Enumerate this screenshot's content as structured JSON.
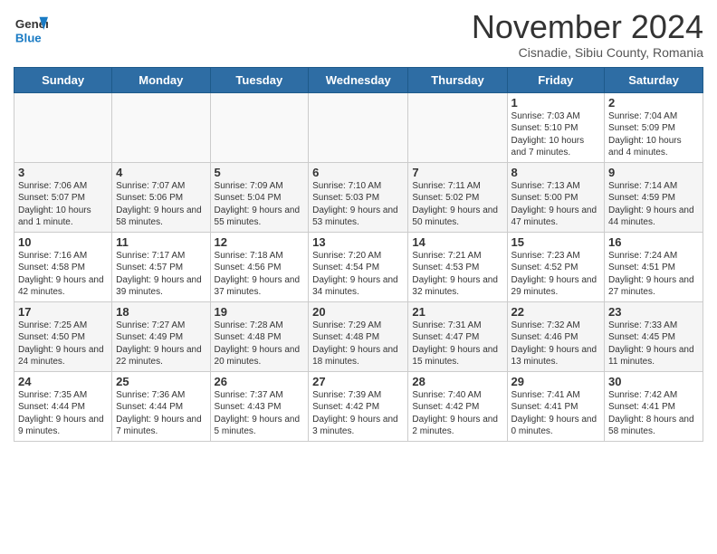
{
  "header": {
    "logo_general": "General",
    "logo_blue": "Blue",
    "month_title": "November 2024",
    "location": "Cisnadie, Sibiu County, Romania"
  },
  "days_of_week": [
    "Sunday",
    "Monday",
    "Tuesday",
    "Wednesday",
    "Thursday",
    "Friday",
    "Saturday"
  ],
  "weeks": [
    {
      "shade": "white",
      "days": [
        {
          "number": "",
          "info": "",
          "empty": true
        },
        {
          "number": "",
          "info": "",
          "empty": true
        },
        {
          "number": "",
          "info": "",
          "empty": true
        },
        {
          "number": "",
          "info": "",
          "empty": true
        },
        {
          "number": "",
          "info": "",
          "empty": true
        },
        {
          "number": "1",
          "info": "Sunrise: 7:03 AM\nSunset: 5:10 PM\nDaylight: 10 hours and 7 minutes."
        },
        {
          "number": "2",
          "info": "Sunrise: 7:04 AM\nSunset: 5:09 PM\nDaylight: 10 hours and 4 minutes."
        }
      ]
    },
    {
      "shade": "gray",
      "days": [
        {
          "number": "3",
          "info": "Sunrise: 7:06 AM\nSunset: 5:07 PM\nDaylight: 10 hours and 1 minute."
        },
        {
          "number": "4",
          "info": "Sunrise: 7:07 AM\nSunset: 5:06 PM\nDaylight: 9 hours and 58 minutes."
        },
        {
          "number": "5",
          "info": "Sunrise: 7:09 AM\nSunset: 5:04 PM\nDaylight: 9 hours and 55 minutes."
        },
        {
          "number": "6",
          "info": "Sunrise: 7:10 AM\nSunset: 5:03 PM\nDaylight: 9 hours and 53 minutes."
        },
        {
          "number": "7",
          "info": "Sunrise: 7:11 AM\nSunset: 5:02 PM\nDaylight: 9 hours and 50 minutes."
        },
        {
          "number": "8",
          "info": "Sunrise: 7:13 AM\nSunset: 5:00 PM\nDaylight: 9 hours and 47 minutes."
        },
        {
          "number": "9",
          "info": "Sunrise: 7:14 AM\nSunset: 4:59 PM\nDaylight: 9 hours and 44 minutes."
        }
      ]
    },
    {
      "shade": "white",
      "days": [
        {
          "number": "10",
          "info": "Sunrise: 7:16 AM\nSunset: 4:58 PM\nDaylight: 9 hours and 42 minutes."
        },
        {
          "number": "11",
          "info": "Sunrise: 7:17 AM\nSunset: 4:57 PM\nDaylight: 9 hours and 39 minutes."
        },
        {
          "number": "12",
          "info": "Sunrise: 7:18 AM\nSunset: 4:56 PM\nDaylight: 9 hours and 37 minutes."
        },
        {
          "number": "13",
          "info": "Sunrise: 7:20 AM\nSunset: 4:54 PM\nDaylight: 9 hours and 34 minutes."
        },
        {
          "number": "14",
          "info": "Sunrise: 7:21 AM\nSunset: 4:53 PM\nDaylight: 9 hours and 32 minutes."
        },
        {
          "number": "15",
          "info": "Sunrise: 7:23 AM\nSunset: 4:52 PM\nDaylight: 9 hours and 29 minutes."
        },
        {
          "number": "16",
          "info": "Sunrise: 7:24 AM\nSunset: 4:51 PM\nDaylight: 9 hours and 27 minutes."
        }
      ]
    },
    {
      "shade": "gray",
      "days": [
        {
          "number": "17",
          "info": "Sunrise: 7:25 AM\nSunset: 4:50 PM\nDaylight: 9 hours and 24 minutes."
        },
        {
          "number": "18",
          "info": "Sunrise: 7:27 AM\nSunset: 4:49 PM\nDaylight: 9 hours and 22 minutes."
        },
        {
          "number": "19",
          "info": "Sunrise: 7:28 AM\nSunset: 4:48 PM\nDaylight: 9 hours and 20 minutes."
        },
        {
          "number": "20",
          "info": "Sunrise: 7:29 AM\nSunset: 4:48 PM\nDaylight: 9 hours and 18 minutes."
        },
        {
          "number": "21",
          "info": "Sunrise: 7:31 AM\nSunset: 4:47 PM\nDaylight: 9 hours and 15 minutes."
        },
        {
          "number": "22",
          "info": "Sunrise: 7:32 AM\nSunset: 4:46 PM\nDaylight: 9 hours and 13 minutes."
        },
        {
          "number": "23",
          "info": "Sunrise: 7:33 AM\nSunset: 4:45 PM\nDaylight: 9 hours and 11 minutes."
        }
      ]
    },
    {
      "shade": "white",
      "days": [
        {
          "number": "24",
          "info": "Sunrise: 7:35 AM\nSunset: 4:44 PM\nDaylight: 9 hours and 9 minutes."
        },
        {
          "number": "25",
          "info": "Sunrise: 7:36 AM\nSunset: 4:44 PM\nDaylight: 9 hours and 7 minutes."
        },
        {
          "number": "26",
          "info": "Sunrise: 7:37 AM\nSunset: 4:43 PM\nDaylight: 9 hours and 5 minutes."
        },
        {
          "number": "27",
          "info": "Sunrise: 7:39 AM\nSunset: 4:42 PM\nDaylight: 9 hours and 3 minutes."
        },
        {
          "number": "28",
          "info": "Sunrise: 7:40 AM\nSunset: 4:42 PM\nDaylight: 9 hours and 2 minutes."
        },
        {
          "number": "29",
          "info": "Sunrise: 7:41 AM\nSunset: 4:41 PM\nDaylight: 9 hours and 0 minutes."
        },
        {
          "number": "30",
          "info": "Sunrise: 7:42 AM\nSunset: 4:41 PM\nDaylight: 8 hours and 58 minutes."
        }
      ]
    }
  ]
}
